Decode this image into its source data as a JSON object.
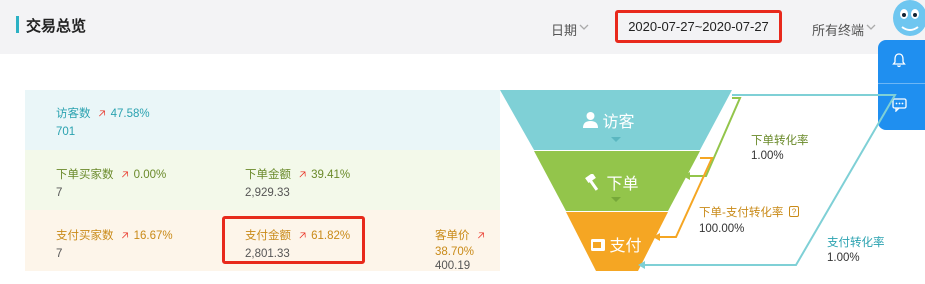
{
  "header": {
    "title": "交易总览",
    "date_label": "日期",
    "date_range": "2020-07-27~2020-07-27",
    "terminal_label": "所有终端"
  },
  "colors": {
    "accent": "#2bb1c4",
    "visitor": "#7fd0d6",
    "order": "#93c54b",
    "pay": "#f5a623",
    "up_arrow": "#e8291c",
    "highlight": "#e8291c",
    "side_panel": "#1f8ff0"
  },
  "icons": {
    "date_chevron": "chevron-down-icon",
    "terminal_chevron": "chevron-down-icon",
    "side_bell": "bell-icon",
    "side_chat": "chat-icon",
    "visitor": "user-icon",
    "order": "hammer-icon",
    "pay": "card-icon",
    "up": "arrow-up-icon"
  },
  "funnel": {
    "visitor": {
      "stage_label": "访客",
      "metrics": [
        {
          "label": "访客数",
          "pct": "47.58%",
          "value": "701"
        }
      ]
    },
    "order": {
      "stage_label": "下单",
      "metrics": [
        {
          "label": "下单买家数",
          "pct": "0.00%",
          "value": "7"
        },
        {
          "label": "下单金额",
          "pct": "39.41%",
          "value": "2,929.33"
        }
      ]
    },
    "pay": {
      "stage_label": "支付",
      "metrics": [
        {
          "label": "支付买家数",
          "pct": "16.67%",
          "value": "7"
        },
        {
          "label": "支付金额",
          "pct": "61.82%",
          "value": "2,801.33"
        },
        {
          "label": "客单价",
          "pct": "38.70%",
          "value": "400.19"
        }
      ]
    }
  },
  "conversions": {
    "order_rate": {
      "label": "下单转化率",
      "value": "1.00%"
    },
    "order_pay_rate": {
      "label": "下单-支付转化率",
      "value": "100.00%"
    },
    "pay_rate": {
      "label": "支付转化率",
      "value": "1.00%"
    }
  }
}
